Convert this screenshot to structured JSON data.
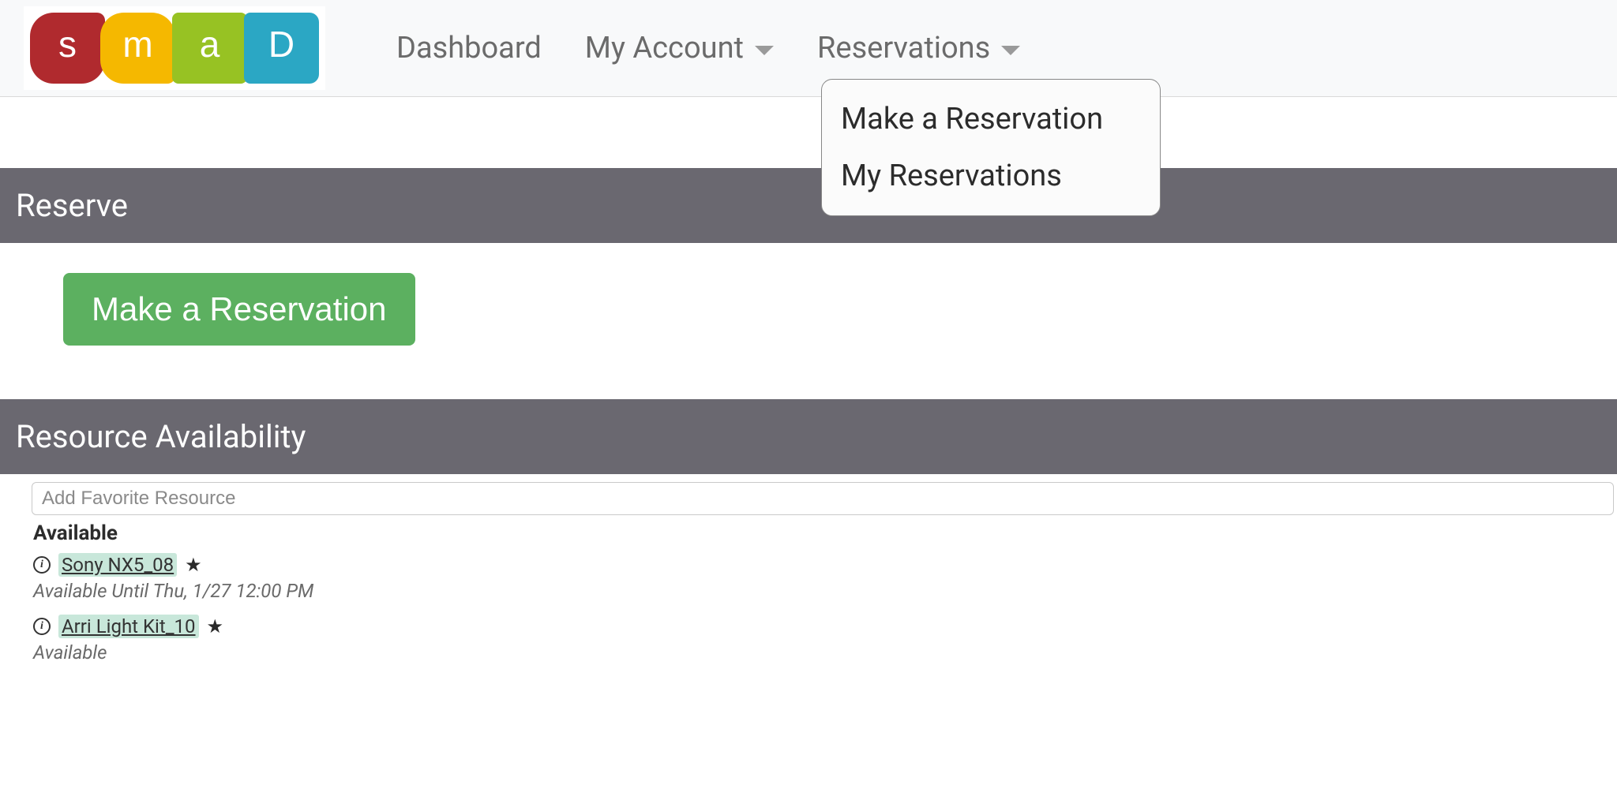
{
  "logo": {
    "s": "s",
    "m": "m",
    "a": "a",
    "d": "D"
  },
  "nav": {
    "dashboard": "Dashboard",
    "myAccount": "My Account",
    "reservations": "Reservations"
  },
  "dropdown": {
    "makeReservation": "Make a Reservation",
    "myReservations": "My Reservations"
  },
  "sections": {
    "reserve": "Reserve",
    "resourceAvailability": "Resource Availability"
  },
  "buttons": {
    "makeReservation": "Make a Reservation"
  },
  "filter": {
    "placeholder": "Add Favorite Resource"
  },
  "availability": {
    "statusHeading": "Available",
    "resources": [
      {
        "name": "Sony NX5_08",
        "status": "Available Until Thu, 1/27 12:00 PM"
      },
      {
        "name": "Arri Light Kit_10",
        "status": "Available"
      }
    ]
  },
  "info_glyph": "i"
}
